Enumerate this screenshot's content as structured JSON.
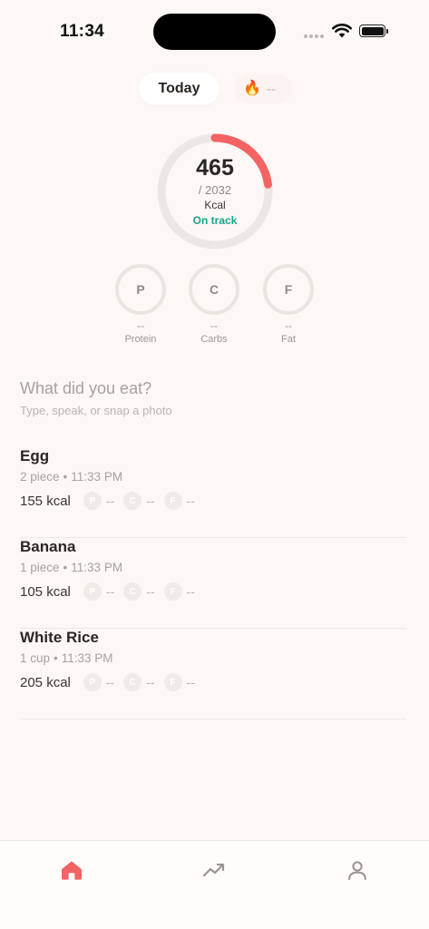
{
  "status_bar": {
    "time": "11:34"
  },
  "header": {
    "date_label": "Today",
    "streak_value": "--"
  },
  "calories": {
    "consumed": "465",
    "goal": "/ 2032",
    "unit": "Kcal",
    "status": "On track",
    "progress": 0.229
  },
  "colors": {
    "accent": "#f46363",
    "track": "#ece7e2",
    "status": "#17a58f",
    "background": "#fdf8f5"
  },
  "macros": [
    {
      "letter": "P",
      "value": "--",
      "label": "Protein"
    },
    {
      "letter": "C",
      "value": "--",
      "label": "Carbs"
    },
    {
      "letter": "F",
      "value": "--",
      "label": "Fat"
    }
  ],
  "input": {
    "placeholder": "What did you eat?",
    "hint": "Type, speak, or snap a photo"
  },
  "entries": [
    {
      "name": "Egg",
      "quantity": "2 piece",
      "time": "11:33 PM",
      "kcal": "155 kcal",
      "protein": "--",
      "carbs": "--",
      "fat": "--"
    },
    {
      "name": "Banana",
      "quantity": "1 piece",
      "time": "11:33 PM",
      "kcal": "105 kcal",
      "protein": "--",
      "carbs": "--",
      "fat": "--"
    },
    {
      "name": "White Rice",
      "quantity": "1 cup",
      "time": "11:33 PM",
      "kcal": "205 kcal",
      "protein": "--",
      "carbs": "--",
      "fat": "--"
    }
  ],
  "chip_letters": {
    "protein": "P",
    "carbs": "C",
    "fat": "F"
  },
  "tabs": [
    {
      "icon": "home-icon",
      "active": true
    },
    {
      "icon": "trending-icon",
      "active": false
    },
    {
      "icon": "profile-icon",
      "active": false
    }
  ]
}
